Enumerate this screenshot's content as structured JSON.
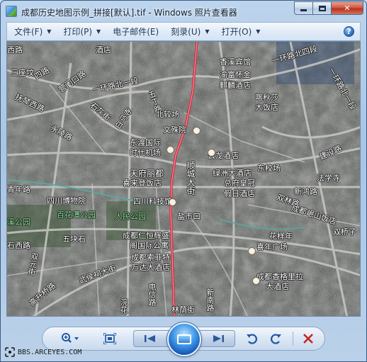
{
  "window": {
    "title": "成都历史地图示例_拼接[默认].tif - Windows 照片查看器"
  },
  "menu": {
    "file": "文件(F)",
    "print": "打印(P)",
    "email": "电子邮件(E)",
    "burn": "刻录(U)",
    "open": "打开(O)",
    "help_icon": "help-icon"
  },
  "map_labels": [
    {
      "text": "酒店"
    },
    {
      "text": "西路"
    },
    {
      "text": "香溪宾馆"
    },
    {
      "text": "一环路北四段"
    },
    {
      "text": "三座坟"
    },
    {
      "text": "四路"
    },
    {
      "text": "营门口路"
    },
    {
      "text": "一环路北一段"
    },
    {
      "text": "五丁路"
    },
    {
      "text": "渝富怀金"
    },
    {
      "text": "麒麟酒店"
    },
    {
      "text": "喀秋莎"
    },
    {
      "text": "大饭店"
    },
    {
      "text": "一环路北一段"
    },
    {
      "text": "抚琴西路"
    },
    {
      "text": "石灰街"
    },
    {
      "text": "白马寺"
    },
    {
      "text": "永陵路"
    },
    {
      "text": "北较场"
    },
    {
      "text": "文殊院"
    },
    {
      "text": "东渡国际"
    },
    {
      "text": "时代机场"
    },
    {
      "text": "云龙酒店"
    },
    {
      "text": "建设路"
    },
    {
      "text": "天府丽都"
    },
    {
      "text": "喜来登饭店"
    },
    {
      "text": "顺城大街"
    },
    {
      "text": "绿洲大酒店"
    },
    {
      "text": "东校场"
    },
    {
      "text": "法学寺"
    },
    {
      "text": "青年路"
    },
    {
      "text": "四川博物院"
    },
    {
      "text": "四川科技馆"
    },
    {
      "text": "总府皇冠"
    },
    {
      "text": "假日酒店"
    },
    {
      "text": "新鸿路"
    },
    {
      "text": "双林路"
    },
    {
      "text": "溪公园"
    },
    {
      "text": "百花潭公园"
    },
    {
      "text": "人民公园"
    },
    {
      "text": "盐市口"
    },
    {
      "text": "五块石"
    },
    {
      "text": "成都岷山饭店"
    },
    {
      "text": "双桥子"
    },
    {
      "text": "石西路"
    },
    {
      "text": "成都仁恒辉盛"
    },
    {
      "text": "阁国际公寓"
    },
    {
      "text": "花样年"
    },
    {
      "text": "喜年广场"
    },
    {
      "text": "双元街"
    },
    {
      "text": "成都索菲特"
    },
    {
      "text": "万达大酒店"
    },
    {
      "text": "武侯祠大街"
    },
    {
      "text": "成都香格里拉"
    },
    {
      "text": "大酒店"
    },
    {
      "text": "高升桥路"
    },
    {
      "text": "电信路"
    },
    {
      "text": "新南路"
    },
    {
      "text": "浣花"
    },
    {
      "text": "林荫街"
    }
  ],
  "toolbar": {
    "zoom_icon": "zoom-magnifier-icon",
    "fit_icon": "actual-size-icon",
    "prev_icon": "previous-icon",
    "slideshow_icon": "slideshow-icon",
    "next_icon": "next-icon",
    "rotate_left_icon": "rotate-counterclockwise-icon",
    "rotate_right_icon": "rotate-clockwise-icon",
    "delete_icon": "delete-icon"
  },
  "watermark": "BBS.ARCEYES.COM"
}
